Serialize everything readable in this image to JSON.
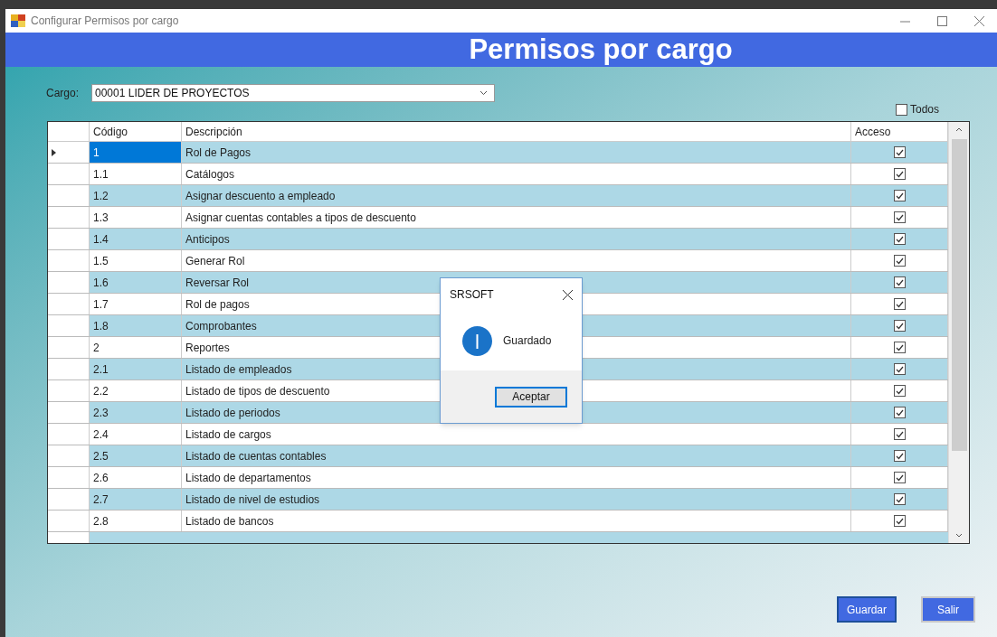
{
  "window": {
    "title": "Configurar Permisos por cargo"
  },
  "header": "Permisos por cargo",
  "cargo": {
    "label": "Cargo:",
    "value": "00001  LIDER DE PROYECTOS"
  },
  "todos": {
    "label": "Todos",
    "checked": false
  },
  "table": {
    "columns": [
      "Código",
      "Descripción",
      "Acceso"
    ],
    "rows": [
      {
        "code": "1",
        "description": "Rol de Pagos",
        "access": true,
        "selected": true
      },
      {
        "code": "1.1",
        "description": "Catálogos",
        "access": true,
        "selected": false
      },
      {
        "code": "1.2",
        "description": "Asignar descuento a empleado",
        "access": true,
        "selected": false
      },
      {
        "code": "1.3",
        "description": "Asignar cuentas contables a tipos de descuento",
        "access": true,
        "selected": false
      },
      {
        "code": "1.4",
        "description": "Anticipos",
        "access": true,
        "selected": false
      },
      {
        "code": "1.5",
        "description": "Generar Rol",
        "access": true,
        "selected": false
      },
      {
        "code": "1.6",
        "description": "Reversar Rol",
        "access": true,
        "selected": false
      },
      {
        "code": "1.7",
        "description": "Rol de pagos",
        "access": true,
        "selected": false
      },
      {
        "code": "1.8",
        "description": "Comprobantes",
        "access": true,
        "selected": false
      },
      {
        "code": "2",
        "description": "Reportes",
        "access": true,
        "selected": false
      },
      {
        "code": "2.1",
        "description": "Listado de empleados",
        "access": true,
        "selected": false
      },
      {
        "code": "2.2",
        "description": "Listado de tipos de descuento",
        "access": true,
        "selected": false
      },
      {
        "code": "2.3",
        "description": "Listado de periodos",
        "access": true,
        "selected": false
      },
      {
        "code": "2.4",
        "description": "Listado de cargos",
        "access": true,
        "selected": false
      },
      {
        "code": "2.5",
        "description": "Listado de cuentas contables",
        "access": true,
        "selected": false
      },
      {
        "code": "2.6",
        "description": "Listado de departamentos",
        "access": true,
        "selected": false
      },
      {
        "code": "2.7",
        "description": "Listado de nivel de estudios",
        "access": true,
        "selected": false
      },
      {
        "code": "2.8",
        "description": "Listado de bancos",
        "access": true,
        "selected": false
      }
    ]
  },
  "dialog": {
    "title": "SRSOFT",
    "message": "Guardado",
    "button": "Aceptar"
  },
  "buttons": [
    "Guardar",
    "Salir"
  ]
}
